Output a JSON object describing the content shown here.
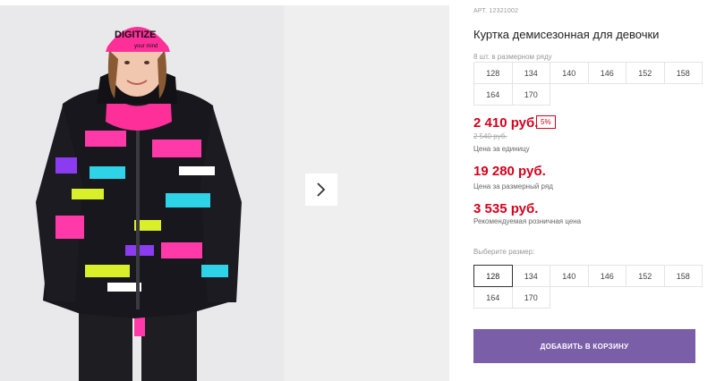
{
  "gallery": {
    "next_icon": "chevron-right-icon",
    "photo_texts": {
      "hat_text": "DIGITIZE",
      "hat_sub": "your mind"
    }
  },
  "product": {
    "article": "АРТ. 12321002",
    "title": "Куртка демисезонная для девочки",
    "pack_label": "8 шт. в размерном ряду",
    "pack_sizes": [
      "128",
      "134",
      "140",
      "146",
      "152",
      "158",
      "164",
      "170"
    ],
    "price": "2 410 руб.",
    "discount": "5%",
    "old_price": "2 540 руб.",
    "price_unit_caption": "Цена за единицу",
    "range_price": "19 280 руб.",
    "range_price_caption": "Цена за размерный ряд",
    "retail_price": "3 535 руб.",
    "retail_price_caption": "Рекомендуемая розничная цена",
    "choose_label": "Выберите размер:",
    "choose_sizes": [
      "128",
      "134",
      "140",
      "146",
      "152",
      "158",
      "164",
      "170"
    ],
    "selected_size": "128",
    "add_to_cart": "ДОБАВИТЬ В КОРЗИНУ"
  },
  "colors": {
    "accent_price": "#d6001c",
    "button": "#7a5ea8",
    "photo_bg": "#e8e8ea"
  }
}
